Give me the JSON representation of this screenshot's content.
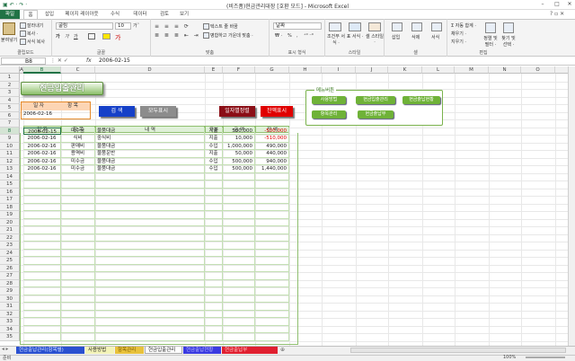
{
  "window": {
    "title": "(비즈폼)현금관리대장 [호환 모드] - Microsoft Excel",
    "min": "–",
    "max": "□",
    "close": "✕"
  },
  "ribbon_tabs": [
    "파일",
    "홈",
    "삽입",
    "페이지 레이아웃",
    "수식",
    "데이터",
    "검토",
    "보기"
  ],
  "ribbon": {
    "clipboard": {
      "paste": "붙여넣기",
      "cut": "잘라내기",
      "copy": "복사 ·",
      "format_painter": "서식 복사",
      "label": "클립보드"
    },
    "font": {
      "name": "굴림",
      "size": "10",
      "label": "글꼴",
      "grow": "가ˆ",
      "shrink": "가ˇ",
      "bold": "가",
      "italic": "가",
      "underline": "가"
    },
    "align": {
      "wrap": "텍스트 줄 바꿈",
      "merge": "병합하고 가운데 맞춤 ·",
      "label": "맞춤"
    },
    "number": {
      "format": "날짜",
      "label": "표시 형식",
      "percent": "%",
      "comma": ","
    },
    "styles": {
      "cond": "조건부 서식 ·",
      "table": "표 서식 ·",
      "cell": "셀 스타일 ·",
      "label": "스타일"
    },
    "cells": {
      "insert": "삽입",
      "delete": "삭제",
      "format": "서식",
      "label": "셀"
    },
    "edit": {
      "autosum": "Σ 자동 합계 ·",
      "fill": "채우기 ·",
      "clear": "지우기 ·",
      "sort": "정렬 및 필터 ·",
      "find": "찾기 및 선택 ·",
      "label": "편집"
    }
  },
  "formula_bar": {
    "name_box": "B8",
    "fx": "fx",
    "value": "2006-02-15"
  },
  "columns": [
    "A",
    "B",
    "C",
    "D",
    "E",
    "F",
    "G",
    "H",
    "I",
    "J",
    "K",
    "L",
    "M",
    "N",
    "O",
    "P"
  ],
  "rows": [
    "1",
    "2",
    "3",
    "4",
    "5",
    "6",
    "7",
    "8",
    "9",
    "10",
    "11",
    "12",
    "13",
    "14",
    "15",
    "16",
    "17",
    "18",
    "19",
    "20",
    "21",
    "22",
    "23",
    "24",
    "25",
    "26",
    "27",
    "28",
    "29",
    "30",
    "31",
    "32",
    "33",
    "34",
    "35"
  ],
  "sheet": {
    "title": "현금입출관리",
    "period": {
      "label_from": "일 자",
      "label_item": "항 목",
      "from_value": "2006-02-16"
    },
    "buttons": {
      "search": "검 색",
      "show_all": "모두표시",
      "sort_date": "일자별정렬",
      "show_balance": "잔액표시"
    },
    "panel": {
      "title": "메뉴버튼",
      "items": [
        "사용방법",
        "현금입출관리",
        "현금출납현황",
        "항목관리",
        "현금출납부"
      ]
    },
    "table": {
      "headers": [
        "일 자",
        "항 목",
        "내 역",
        "구분",
        "금 액",
        "잔 액"
      ],
      "rows": [
        [
          "2006-02-15",
          "미수금",
          "물품대금",
          "지출",
          "500,000",
          "-500,000"
        ],
        [
          "2006-02-16",
          "식비",
          "중식비",
          "지출",
          "10,000",
          "-510,000"
        ],
        [
          "2006-02-16",
          "판매비",
          "물품대금",
          "수입",
          "1,000,000",
          "490,000"
        ],
        [
          "2006-02-16",
          "용역비",
          "물품운반",
          "지출",
          "50,000",
          "440,000"
        ],
        [
          "2006-02-16",
          "미수금",
          "물품대금",
          "수입",
          "500,000",
          "940,000"
        ],
        [
          "2006-02-16",
          "미수금",
          "물품대금",
          "수입",
          "500,000",
          "1,440,000"
        ]
      ]
    }
  },
  "sheet_tabs": [
    "현금출납관리(항목별)",
    "사용방법",
    "항목관리",
    "현금입출관리",
    "현금출납현황",
    "현금출납부"
  ],
  "status": {
    "left": "준비",
    "zoom": "100%"
  }
}
